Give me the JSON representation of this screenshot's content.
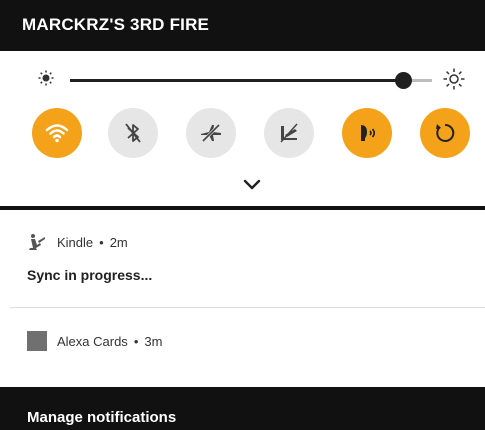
{
  "header": {
    "title": "MARCKRZ'S 3RD FIRE"
  },
  "brightness": {
    "level_percent": 92
  },
  "quick_settings": [
    {
      "name": "wifi",
      "icon": "wifi-icon",
      "active": true
    },
    {
      "name": "bluetooth",
      "icon": "bluetooth-off-icon",
      "active": false
    },
    {
      "name": "airplane-mode",
      "icon": "airplane-off-icon",
      "active": false
    },
    {
      "name": "show-mode",
      "icon": "show-mode-off-icon",
      "active": false
    },
    {
      "name": "alexa-hands-free",
      "icon": "alexa-hands-free-icon",
      "active": true
    },
    {
      "name": "auto-rotate",
      "icon": "rotate-icon",
      "active": true
    }
  ],
  "colors": {
    "active": "#F5A21B",
    "inactive": "#E6E6E6",
    "header": "#111111"
  },
  "notifications": [
    {
      "app": "Kindle",
      "separator": "•",
      "time": "2m",
      "message": "Sync in progress..."
    },
    {
      "app": "Alexa Cards",
      "separator": "•",
      "time": "3m"
    }
  ],
  "footer": {
    "manage_label": "Manage notifications"
  }
}
